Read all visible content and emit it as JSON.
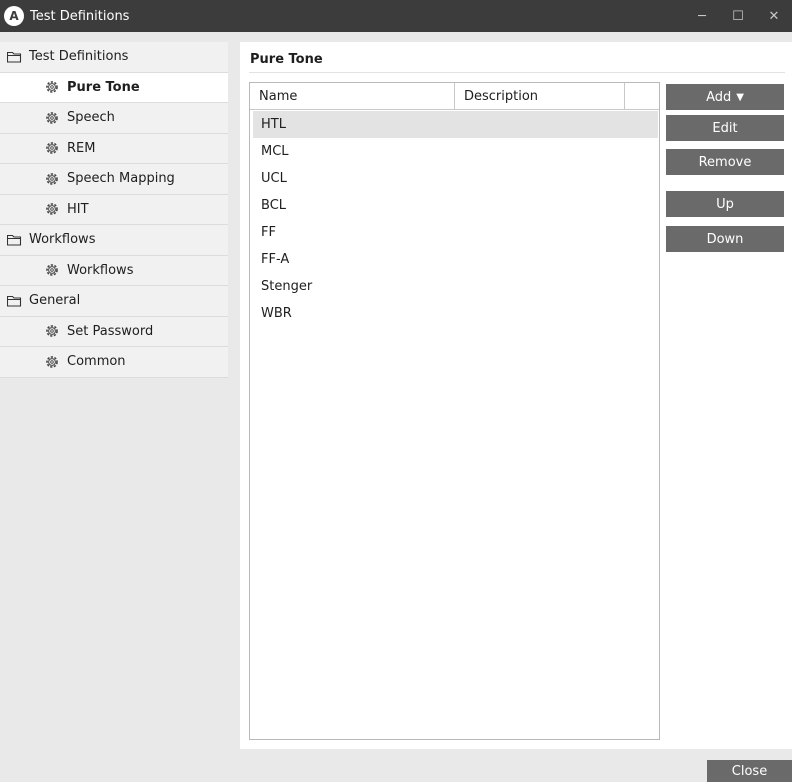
{
  "window": {
    "title": "Test Definitions",
    "app_badge": "A",
    "controls": {
      "minimize": "─",
      "maximize": "☐",
      "close": "✕"
    }
  },
  "sidebar": {
    "items": [
      {
        "label": "Test Definitions",
        "type": "group",
        "icon": "folder-icon"
      },
      {
        "label": "Pure Tone",
        "type": "child",
        "icon": "gear-icon",
        "selected": true
      },
      {
        "label": "Speech",
        "type": "child",
        "icon": "gear-icon"
      },
      {
        "label": "REM",
        "type": "child",
        "icon": "gear-icon"
      },
      {
        "label": "Speech Mapping",
        "type": "child",
        "icon": "gear-icon"
      },
      {
        "label": "HIT",
        "type": "child",
        "icon": "gear-icon"
      },
      {
        "label": "Workflows",
        "type": "group",
        "icon": "folder-icon"
      },
      {
        "label": "Workflows",
        "type": "child",
        "icon": "gear-icon"
      },
      {
        "label": "General",
        "type": "group",
        "icon": "folder-icon"
      },
      {
        "label": "Set Password",
        "type": "child",
        "icon": "gear-icon"
      },
      {
        "label": "Common",
        "type": "child",
        "icon": "gear-icon"
      }
    ]
  },
  "main": {
    "title": "Pure Tone",
    "columns": [
      "Name",
      "Description"
    ],
    "rows": [
      {
        "name": "HTL",
        "description": "",
        "selected": true
      },
      {
        "name": "MCL",
        "description": ""
      },
      {
        "name": "UCL",
        "description": ""
      },
      {
        "name": "BCL",
        "description": ""
      },
      {
        "name": "FF",
        "description": ""
      },
      {
        "name": "FF-A",
        "description": ""
      },
      {
        "name": "Stenger",
        "description": ""
      },
      {
        "name": "WBR",
        "description": ""
      }
    ],
    "buttons": {
      "add": "Add",
      "add_caret": "▼",
      "edit": "Edit",
      "remove": "Remove",
      "up": "Up",
      "down": "Down"
    }
  },
  "footer": {
    "close": "Close"
  },
  "colors": {
    "titlebar": "#3c3c3c",
    "button": "#6a6a6a",
    "selected_row": "#e3e3e3",
    "sidebar": "#f1f1f1"
  }
}
